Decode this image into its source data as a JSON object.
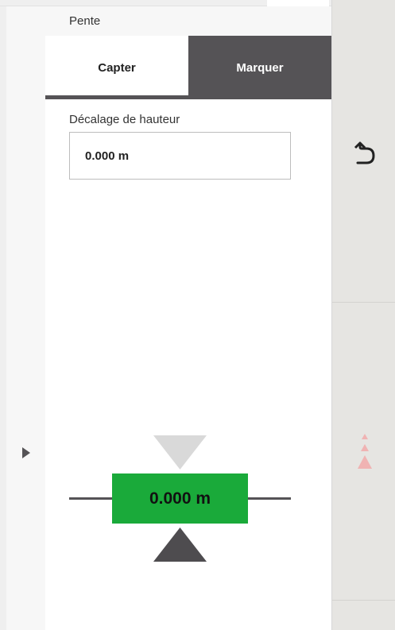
{
  "panel": {
    "title": "Pente"
  },
  "tabs": [
    {
      "label": "Capter",
      "active": true
    },
    {
      "label": "Marquer",
      "active": false
    }
  ],
  "height_offset": {
    "label": "Décalage de hauteur",
    "value": "0.000 m"
  },
  "indicator": {
    "value": "0.000 m",
    "box_color": "#1aaa3a",
    "arrow_up_color": "#4e4c4f",
    "arrow_down_color": "#d9d9d9"
  },
  "icons": {
    "expand": "expand-right-icon",
    "undo": "undo-icon",
    "stack": "triangle-stack-icon"
  },
  "colors": {
    "dark": "#555356",
    "accent_pink": "#f0b3b3"
  }
}
